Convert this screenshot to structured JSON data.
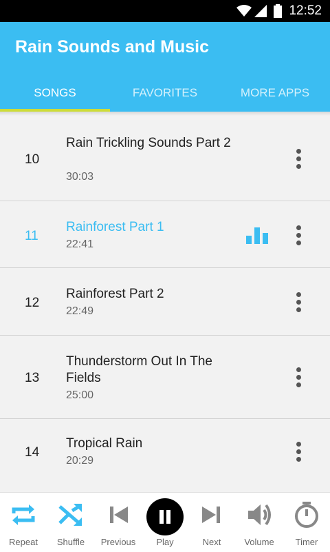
{
  "status": {
    "time": "12:52"
  },
  "app": {
    "title": "Rain Sounds and Music"
  },
  "tabs": [
    {
      "label": "SONGS"
    },
    {
      "label": "FAVORITES"
    },
    {
      "label": "MORE APPS"
    }
  ],
  "songs": [
    {
      "number": "10",
      "title": "Rain Trickling Sounds Part 2",
      "duration": "30:03"
    },
    {
      "number": "11",
      "title": "Rainforest Part 1",
      "duration": "22:41"
    },
    {
      "number": "12",
      "title": "Rainforest Part 2",
      "duration": "22:49"
    },
    {
      "number": "13",
      "title": "Thunderstorm Out In The Fields",
      "duration": "25:00"
    },
    {
      "number": "14",
      "title": "Tropical Rain",
      "duration": "20:29"
    }
  ],
  "controls": [
    {
      "label": "Repeat"
    },
    {
      "label": "Shuffle"
    },
    {
      "label": "Previous"
    },
    {
      "label": "Play"
    },
    {
      "label": "Next"
    },
    {
      "label": "Volume"
    },
    {
      "label": "Timer"
    }
  ],
  "colors": {
    "accent": "#3bbdf2",
    "tab_indicator": "#cddc39"
  },
  "icons": [
    "wifi-icon",
    "signal-icon",
    "battery-icon",
    "more-vert-icon",
    "equalizer-icon",
    "repeat-icon",
    "shuffle-icon",
    "skip-previous-icon",
    "pause-icon",
    "skip-next-icon",
    "volume-icon",
    "timer-icon"
  ]
}
